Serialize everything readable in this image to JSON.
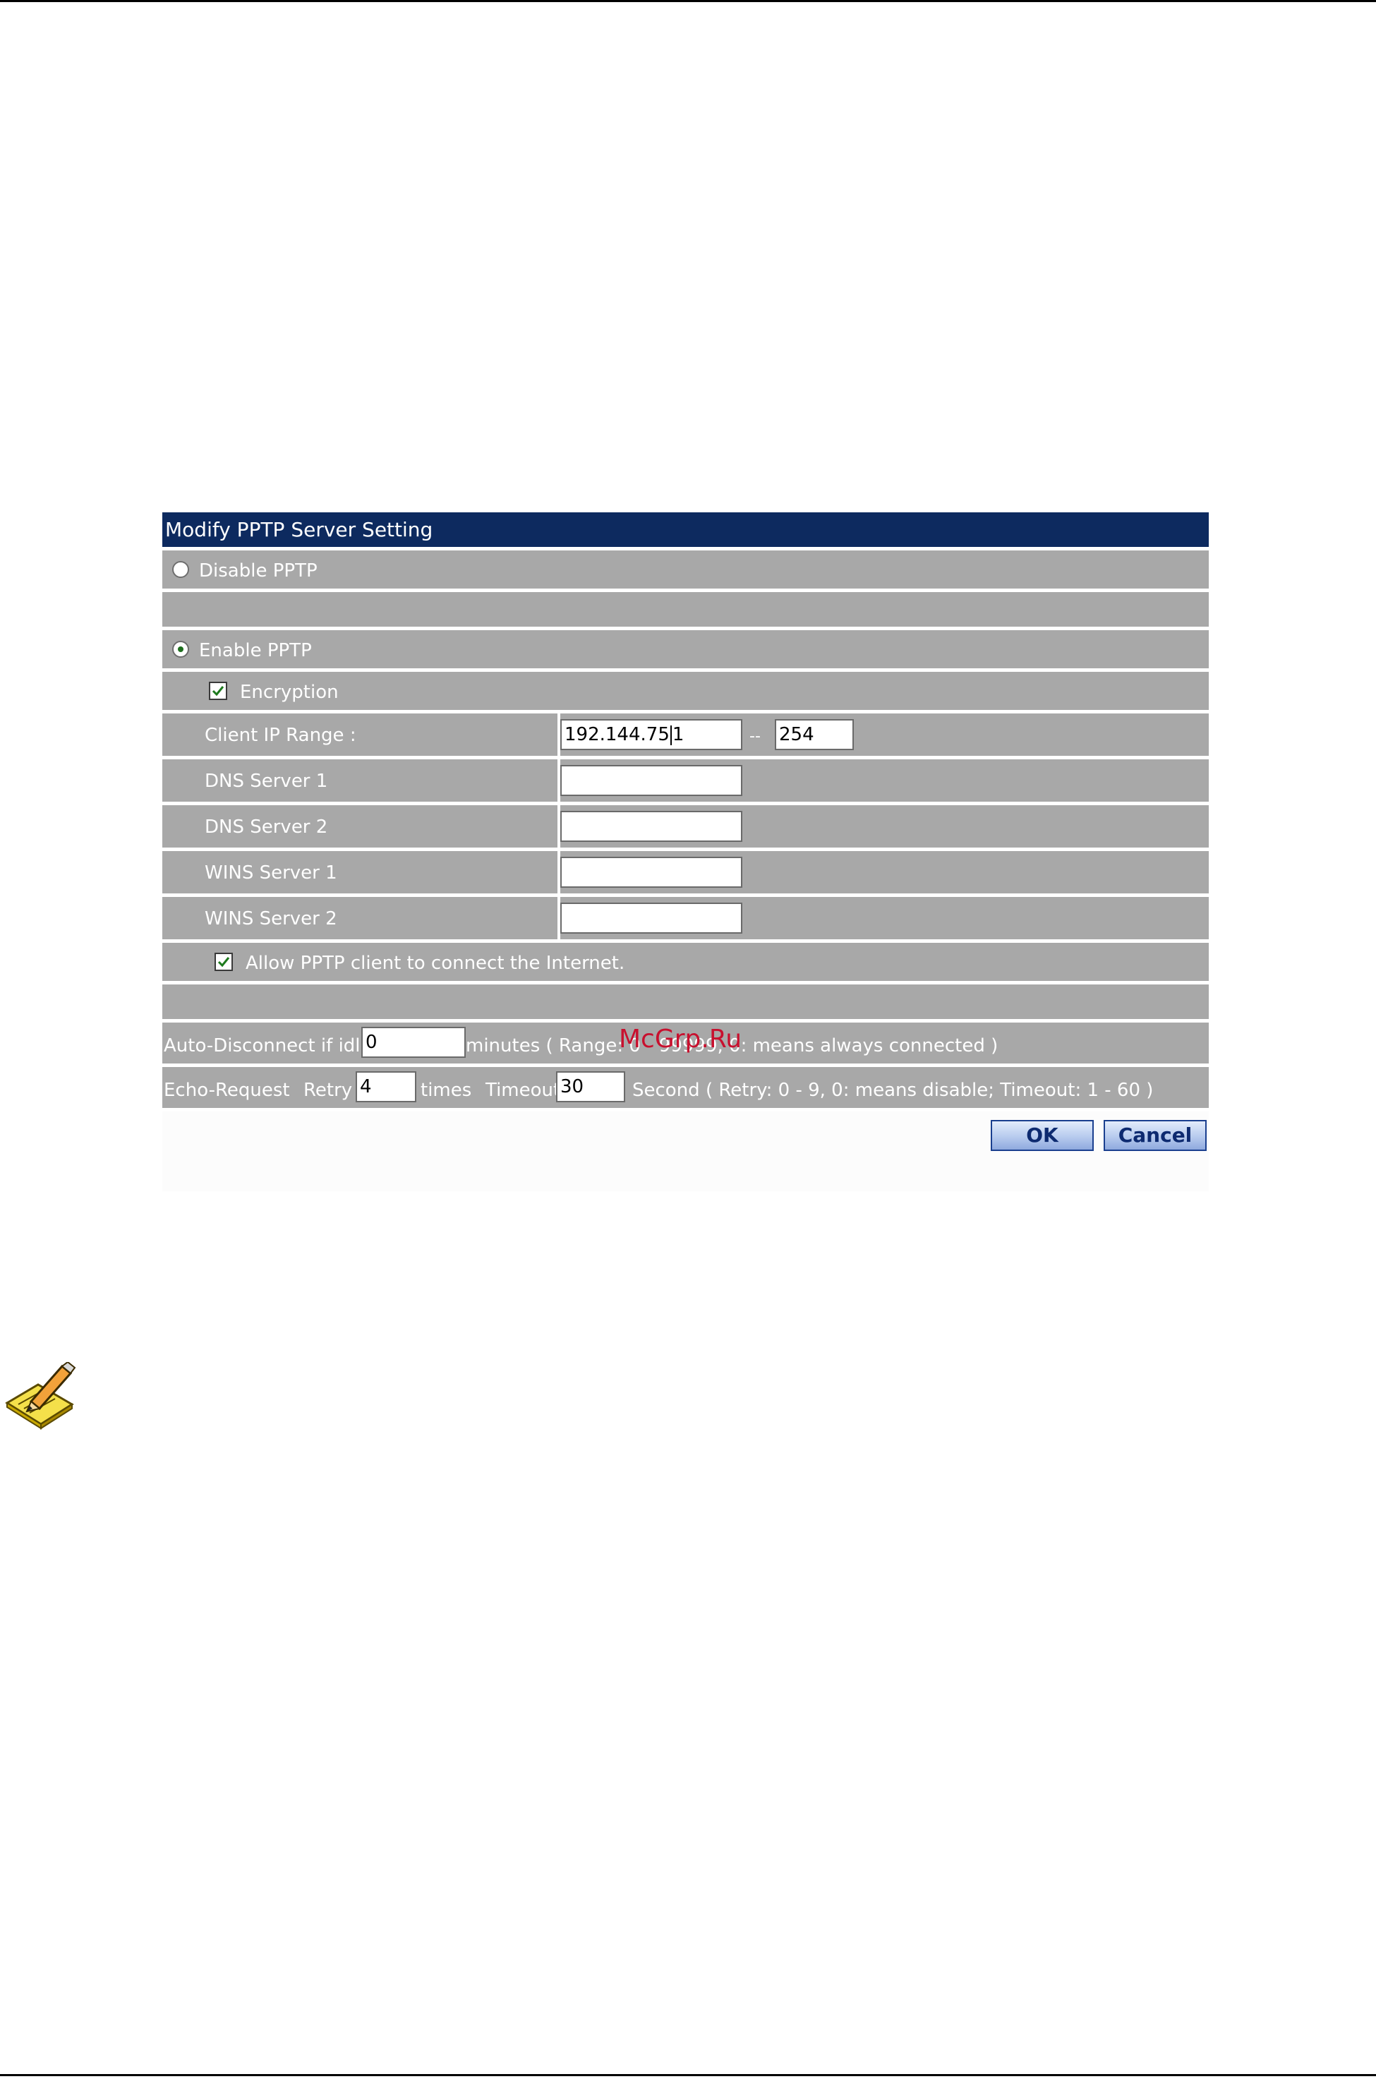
{
  "panel": {
    "title": "Modify PPTP Server Setting",
    "disable_label": "Disable PPTP",
    "enable_label": "Enable PPTP",
    "selected_mode": "enable",
    "encryption_label": "Encryption",
    "encryption_checked": true,
    "client_ip_label": "Client IP Range :",
    "client_ip_start_before_caret": "192.144.75",
    "client_ip_start_after_caret": "1",
    "range_separator": "--",
    "client_ip_end": "254",
    "dns1_label": "DNS Server 1",
    "dns1_value": "",
    "dns2_label": "DNS Server 2",
    "dns2_value": "",
    "wins1_label": "WINS Server 1",
    "wins1_value": "",
    "wins2_label": "WINS Server 2",
    "wins2_value": "",
    "allow_internet_label": "Allow PPTP client to connect the Internet.",
    "allow_internet_checked": true,
    "auto_disconnect_label": "Auto-Disconnect if idle",
    "auto_disconnect_value": "0",
    "auto_disconnect_hint": "minutes ( Range: 0 - 99999, 0: means always connected )",
    "echo_label": "Echo-Request",
    "retry_label": "Retry",
    "retry_value": "4",
    "times_label": "times",
    "timeout_label": "Timeout",
    "timeout_value": "30",
    "echo_hint": "Second ( Retry: 0 - 9, 0: means disable; Timeout: 1 - 60 )",
    "ok_label": "OK",
    "cancel_label": "Cancel"
  },
  "watermark": "McGrp.Ru",
  "icons": {
    "note": "note-pencil-icon"
  },
  "colors": {
    "header_bg": "#0d2a5f",
    "row_bg": "#a8a8a8",
    "watermark": "#c8102e"
  }
}
